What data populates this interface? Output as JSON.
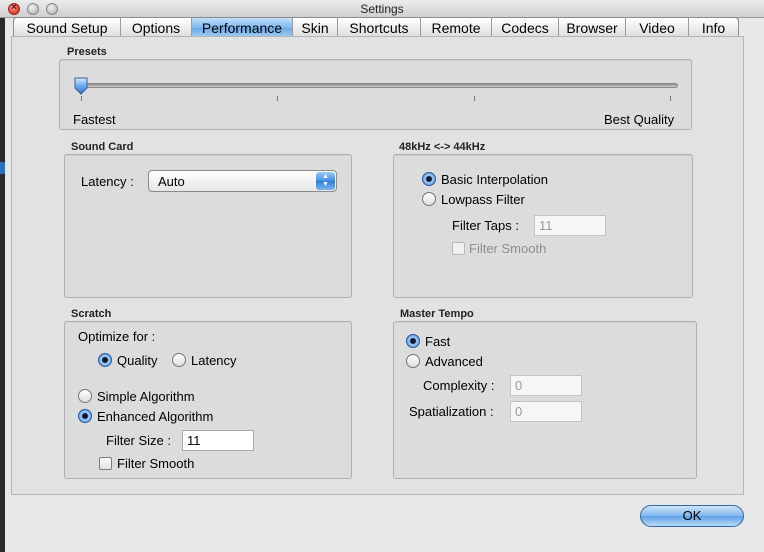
{
  "window": {
    "title": "Settings"
  },
  "tabs": [
    {
      "label": "Sound Setup",
      "active": false
    },
    {
      "label": "Options",
      "active": false
    },
    {
      "label": "Performance",
      "active": true
    },
    {
      "label": "Skin",
      "active": false
    },
    {
      "label": "Shortcuts",
      "active": false
    },
    {
      "label": "Remote",
      "active": false
    },
    {
      "label": "Codecs",
      "active": false
    },
    {
      "label": "Browser",
      "active": false
    },
    {
      "label": "Video",
      "active": false
    },
    {
      "label": "Info",
      "active": false
    }
  ],
  "presets": {
    "label": "Presets",
    "min_label": "Fastest",
    "max_label": "Best Quality",
    "value_fraction": 0.0
  },
  "sound_card": {
    "label": "Sound Card",
    "latency_label": "Latency :",
    "latency_value": "Auto"
  },
  "resample": {
    "label": "48kHz <-> 44kHz",
    "basic_label": "Basic Interpolation",
    "basic_selected": true,
    "lowpass_label": "Lowpass Filter",
    "lowpass_selected": false,
    "filter_taps_label": "Filter Taps :",
    "filter_taps_value": "11",
    "filter_smooth_label": "Filter Smooth",
    "filter_smooth_checked": false
  },
  "scratch": {
    "label": "Scratch",
    "optimize_label": "Optimize for :",
    "quality_label": "Quality",
    "quality_selected": true,
    "latency_label": "Latency",
    "latency_selected": false,
    "simple_label": "Simple Algorithm",
    "simple_selected": false,
    "enhanced_label": "Enhanced Algorithm",
    "enhanced_selected": true,
    "filter_size_label": "Filter Size :",
    "filter_size_value": "11",
    "filter_smooth_label": "Filter Smooth",
    "filter_smooth_checked": false
  },
  "master_tempo": {
    "label": "Master Tempo",
    "fast_label": "Fast",
    "fast_selected": true,
    "advanced_label": "Advanced",
    "advanced_selected": false,
    "complexity_label": "Complexity :",
    "complexity_value": "0",
    "spatialization_label": "Spatialization :",
    "spatialization_value": "0"
  },
  "buttons": {
    "ok": "OK"
  }
}
